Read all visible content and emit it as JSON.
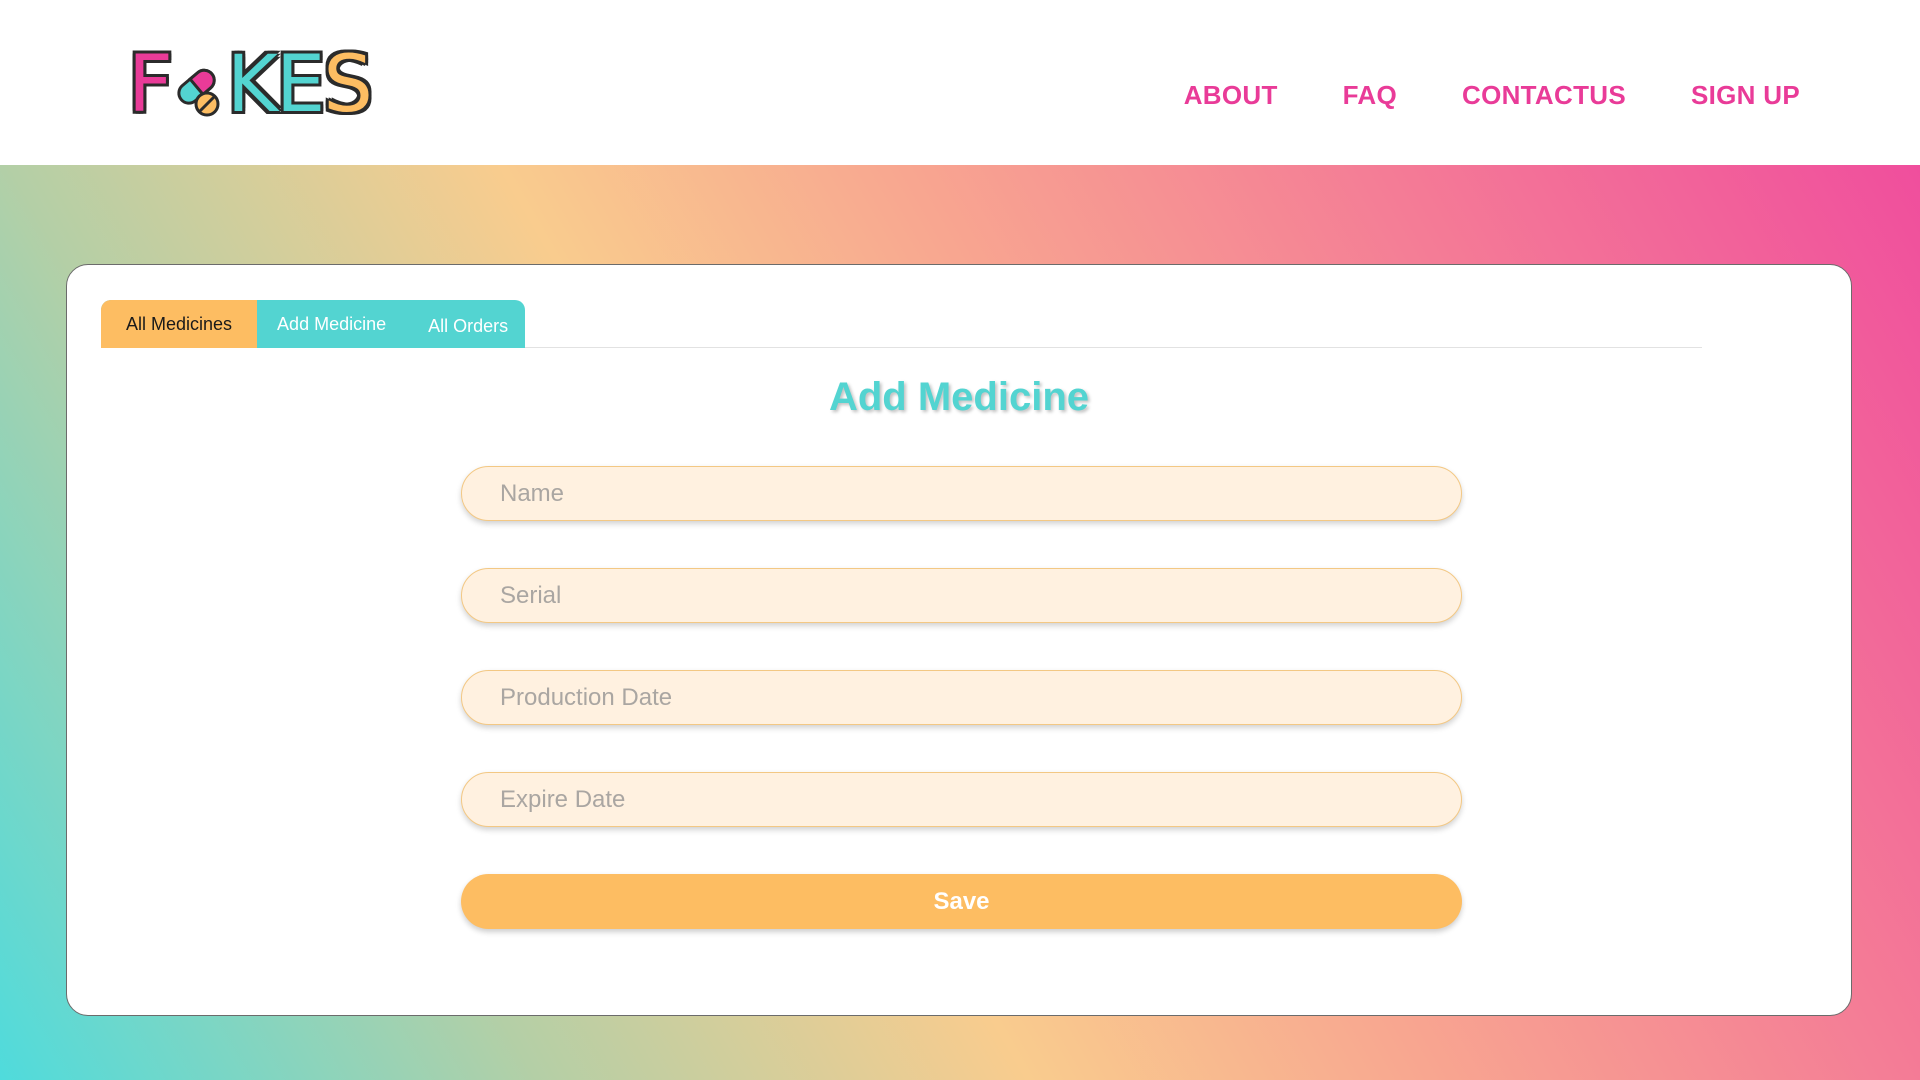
{
  "brand": {
    "logo_text_left": "F",
    "logo_text_right": "KES",
    "logo_icon": "pill-icon",
    "colors": {
      "pink": "#e93b98",
      "teal": "#53d4d1",
      "orange": "#fdbd62"
    }
  },
  "nav": {
    "items": [
      {
        "label": "ABOUT"
      },
      {
        "label": "FAQ"
      },
      {
        "label": "CONTACTUS"
      },
      {
        "label": "SIGN UP"
      }
    ]
  },
  "tabs": [
    {
      "label": "All Medicines",
      "active": true
    },
    {
      "label": "Add Medicine",
      "active": false
    },
    {
      "label": "All Orders",
      "active": false
    }
  ],
  "form": {
    "title": "Add Medicine",
    "fields": [
      {
        "placeholder": "Name",
        "value": ""
      },
      {
        "placeholder": "Serial",
        "value": ""
      },
      {
        "placeholder": "Production Date",
        "value": ""
      },
      {
        "placeholder": "Expire Date",
        "value": ""
      }
    ],
    "save_label": "Save"
  }
}
